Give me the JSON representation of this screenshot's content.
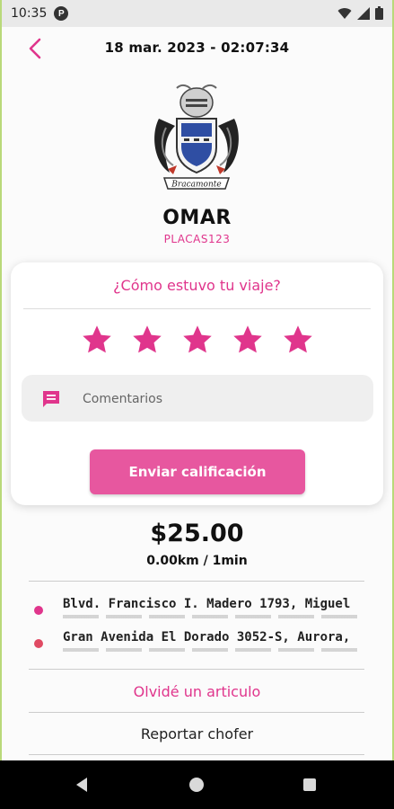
{
  "status_bar": {
    "time": "10:35",
    "notification_glyph": "P",
    "icons": [
      "wifi-icon",
      "signal-icon",
      "battery-icon"
    ]
  },
  "header": {
    "datetime": "18 mar. 2023 - 02:07:34",
    "back_icon": "chevron-left-icon"
  },
  "driver": {
    "name": "OMAR",
    "plate": "PLACAS123",
    "crest_banner": "Bracamonte"
  },
  "rating": {
    "question": "¿Cómo estuvo tu viaje?",
    "stars_total": 5,
    "stars_selected": 5,
    "comment_placeholder": "Comentarios",
    "comment_value": "",
    "submit_label": "Enviar calificación"
  },
  "trip": {
    "price": "$25.00",
    "distance_time": "0.00km / 1min",
    "origin": "Blvd. Francisco I. Madero 1793, Miguel",
    "destination": "Gran Avenida El Dorado 3052-S, Aurora,"
  },
  "actions": {
    "forgot_item": "Olvidé un articulo",
    "report_driver": "Reportar chofer"
  },
  "colors": {
    "accent": "#e0358c",
    "button": "#e7579f",
    "origin_dot": "#e0358c",
    "destination_dot": "#e04a63"
  }
}
